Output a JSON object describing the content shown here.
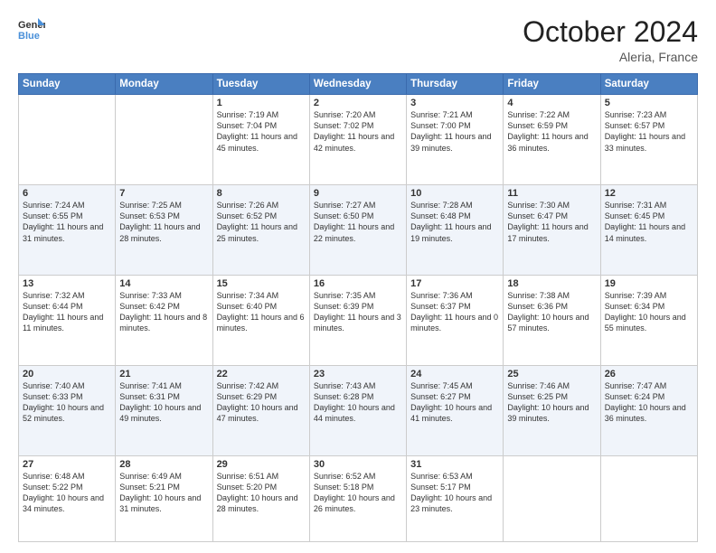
{
  "header": {
    "logo_line1": "General",
    "logo_line2": "Blue",
    "month": "October 2024",
    "location": "Aleria, France"
  },
  "days_of_week": [
    "Sunday",
    "Monday",
    "Tuesday",
    "Wednesday",
    "Thursday",
    "Friday",
    "Saturday"
  ],
  "weeks": [
    [
      {
        "day": "",
        "info": ""
      },
      {
        "day": "",
        "info": ""
      },
      {
        "day": "1",
        "info": "Sunrise: 7:19 AM\nSunset: 7:04 PM\nDaylight: 11 hours and 45 minutes."
      },
      {
        "day": "2",
        "info": "Sunrise: 7:20 AM\nSunset: 7:02 PM\nDaylight: 11 hours and 42 minutes."
      },
      {
        "day": "3",
        "info": "Sunrise: 7:21 AM\nSunset: 7:00 PM\nDaylight: 11 hours and 39 minutes."
      },
      {
        "day": "4",
        "info": "Sunrise: 7:22 AM\nSunset: 6:59 PM\nDaylight: 11 hours and 36 minutes."
      },
      {
        "day": "5",
        "info": "Sunrise: 7:23 AM\nSunset: 6:57 PM\nDaylight: 11 hours and 33 minutes."
      }
    ],
    [
      {
        "day": "6",
        "info": "Sunrise: 7:24 AM\nSunset: 6:55 PM\nDaylight: 11 hours and 31 minutes."
      },
      {
        "day": "7",
        "info": "Sunrise: 7:25 AM\nSunset: 6:53 PM\nDaylight: 11 hours and 28 minutes."
      },
      {
        "day": "8",
        "info": "Sunrise: 7:26 AM\nSunset: 6:52 PM\nDaylight: 11 hours and 25 minutes."
      },
      {
        "day": "9",
        "info": "Sunrise: 7:27 AM\nSunset: 6:50 PM\nDaylight: 11 hours and 22 minutes."
      },
      {
        "day": "10",
        "info": "Sunrise: 7:28 AM\nSunset: 6:48 PM\nDaylight: 11 hours and 19 minutes."
      },
      {
        "day": "11",
        "info": "Sunrise: 7:30 AM\nSunset: 6:47 PM\nDaylight: 11 hours and 17 minutes."
      },
      {
        "day": "12",
        "info": "Sunrise: 7:31 AM\nSunset: 6:45 PM\nDaylight: 11 hours and 14 minutes."
      }
    ],
    [
      {
        "day": "13",
        "info": "Sunrise: 7:32 AM\nSunset: 6:44 PM\nDaylight: 11 hours and 11 minutes."
      },
      {
        "day": "14",
        "info": "Sunrise: 7:33 AM\nSunset: 6:42 PM\nDaylight: 11 hours and 8 minutes."
      },
      {
        "day": "15",
        "info": "Sunrise: 7:34 AM\nSunset: 6:40 PM\nDaylight: 11 hours and 6 minutes."
      },
      {
        "day": "16",
        "info": "Sunrise: 7:35 AM\nSunset: 6:39 PM\nDaylight: 11 hours and 3 minutes."
      },
      {
        "day": "17",
        "info": "Sunrise: 7:36 AM\nSunset: 6:37 PM\nDaylight: 11 hours and 0 minutes."
      },
      {
        "day": "18",
        "info": "Sunrise: 7:38 AM\nSunset: 6:36 PM\nDaylight: 10 hours and 57 minutes."
      },
      {
        "day": "19",
        "info": "Sunrise: 7:39 AM\nSunset: 6:34 PM\nDaylight: 10 hours and 55 minutes."
      }
    ],
    [
      {
        "day": "20",
        "info": "Sunrise: 7:40 AM\nSunset: 6:33 PM\nDaylight: 10 hours and 52 minutes."
      },
      {
        "day": "21",
        "info": "Sunrise: 7:41 AM\nSunset: 6:31 PM\nDaylight: 10 hours and 49 minutes."
      },
      {
        "day": "22",
        "info": "Sunrise: 7:42 AM\nSunset: 6:29 PM\nDaylight: 10 hours and 47 minutes."
      },
      {
        "day": "23",
        "info": "Sunrise: 7:43 AM\nSunset: 6:28 PM\nDaylight: 10 hours and 44 minutes."
      },
      {
        "day": "24",
        "info": "Sunrise: 7:45 AM\nSunset: 6:27 PM\nDaylight: 10 hours and 41 minutes."
      },
      {
        "day": "25",
        "info": "Sunrise: 7:46 AM\nSunset: 6:25 PM\nDaylight: 10 hours and 39 minutes."
      },
      {
        "day": "26",
        "info": "Sunrise: 7:47 AM\nSunset: 6:24 PM\nDaylight: 10 hours and 36 minutes."
      }
    ],
    [
      {
        "day": "27",
        "info": "Sunrise: 6:48 AM\nSunset: 5:22 PM\nDaylight: 10 hours and 34 minutes."
      },
      {
        "day": "28",
        "info": "Sunrise: 6:49 AM\nSunset: 5:21 PM\nDaylight: 10 hours and 31 minutes."
      },
      {
        "day": "29",
        "info": "Sunrise: 6:51 AM\nSunset: 5:20 PM\nDaylight: 10 hours and 28 minutes."
      },
      {
        "day": "30",
        "info": "Sunrise: 6:52 AM\nSunset: 5:18 PM\nDaylight: 10 hours and 26 minutes."
      },
      {
        "day": "31",
        "info": "Sunrise: 6:53 AM\nSunset: 5:17 PM\nDaylight: 10 hours and 23 minutes."
      },
      {
        "day": "",
        "info": ""
      },
      {
        "day": "",
        "info": ""
      }
    ]
  ]
}
